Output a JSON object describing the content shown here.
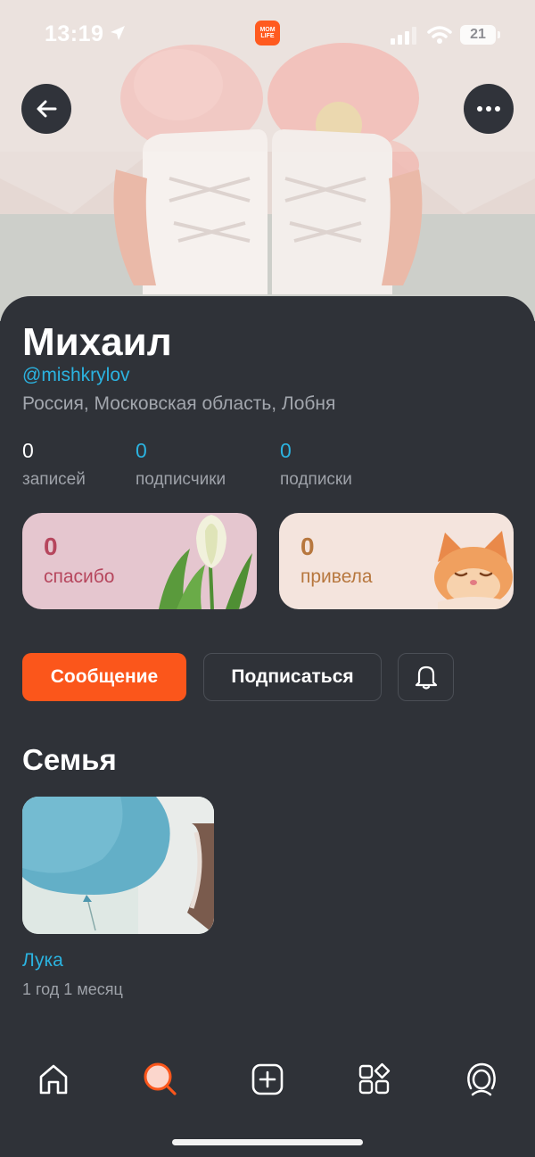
{
  "status_bar": {
    "time": "13:19",
    "battery": "21",
    "app_badge_line1": "MOM",
    "app_badge_line2": "LIFE"
  },
  "profile": {
    "name": "Михаил",
    "handle": "@mishkrylov",
    "location": "Россия, Московская область, Лобня"
  },
  "stats": [
    {
      "value": "0",
      "label": "записей"
    },
    {
      "value": "0",
      "label": "подписчики"
    },
    {
      "value": "0",
      "label": "подписки"
    }
  ],
  "cards": {
    "thanks": {
      "value": "0",
      "label": "спасибо",
      "color": "#b6465d"
    },
    "brought": {
      "value": "0",
      "label": "привела",
      "color": "#b7773e"
    }
  },
  "actions": {
    "message_label": "Сообщение",
    "subscribe_label": "Подписаться"
  },
  "family": {
    "title": "Семья",
    "children": [
      {
        "name": "Лука",
        "age": "1 год 1 месяц"
      }
    ]
  },
  "colors": {
    "accent": "#fb561b",
    "link": "#2bb3e0",
    "background": "#2f3238"
  },
  "icons": {
    "back": "arrow-left-icon",
    "more": "more-horizontal-icon",
    "bell": "bell-icon",
    "nav": [
      "home-icon",
      "search-icon",
      "add-post-icon",
      "services-icon",
      "profile-icon"
    ]
  }
}
